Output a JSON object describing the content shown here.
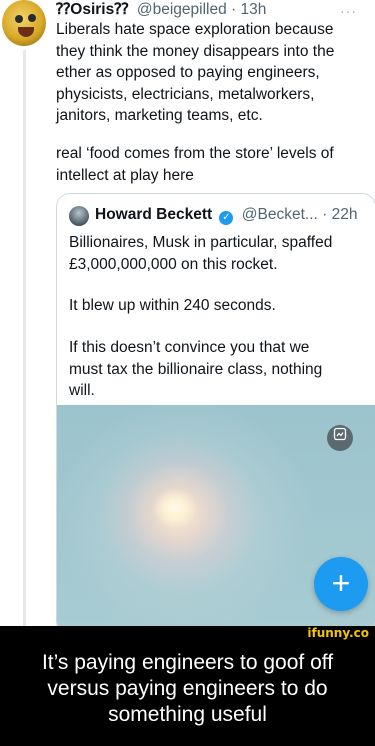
{
  "tweet": {
    "author_name": "⁇Osiris⁇",
    "author_handle": "@beigepilled",
    "time": "13h",
    "more": "···",
    "text_p1": "Liberals hate space exploration because\nthey think the money disappears into the\nether as opposed to paying engineers,\nphysicists, electricians, metalworkers,\njanitors, marketing teams, etc.",
    "text_p2": "real ‘food comes from the store’ levels of\nintellect at play here"
  },
  "quoted_tweet": {
    "author_name": "Howard Beckett",
    "author_handle": "@Becket...",
    "time": "22h",
    "text_p1": "Billionaires, Musk in particular, spaffed\n£3,000,000,000 on this rocket.",
    "text_p2": "It blew up within 240 seconds.",
    "text_p3": "If this doesn’t convince you that we\nmust tax the billionaire class, nothing\nwill."
  },
  "fab": {
    "icon": "plus-icon",
    "label": "+"
  },
  "caption": {
    "watermark": "ifunny.co",
    "text": "It’s paying engineers to goof off\nversus paying engineers to do\nsomething useful"
  },
  "colors": {
    "accent": "#1d9bf0",
    "watermark": "#f5c400",
    "secondary_text": "#536471"
  }
}
